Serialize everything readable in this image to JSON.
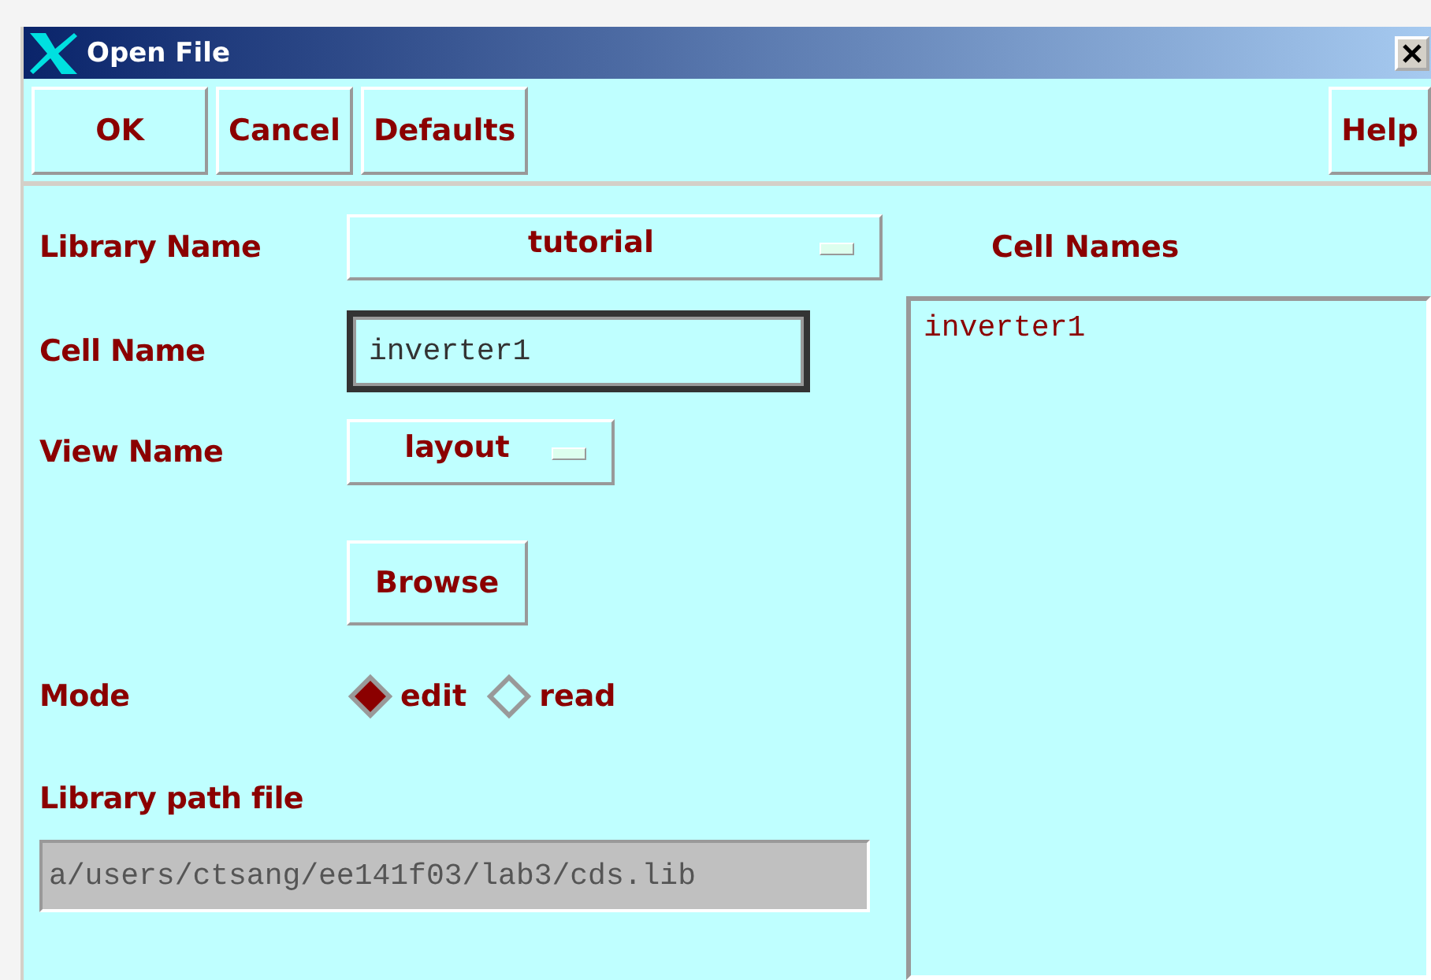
{
  "window": {
    "title": "Open File"
  },
  "toolbar": {
    "left_buttons": [
      "OK",
      "Cancel",
      "Defaults"
    ],
    "right_buttons": [
      "Help"
    ]
  },
  "library_name": {
    "label": "Library Name",
    "value": "tutorial"
  },
  "cell_name": {
    "label": "Cell Name",
    "value": "inverter1"
  },
  "view_name": {
    "label": "View Name",
    "value": "layout"
  },
  "browse_button": "Browse",
  "mode": {
    "label": "Mode",
    "options": [
      {
        "label": "edit",
        "selected": true
      },
      {
        "label": "read",
        "selected": false
      }
    ]
  },
  "library_path": {
    "label": "Library path file",
    "value": "a/users/ctsang/ee141f03/lab3/cds.lib"
  },
  "cell_names": {
    "title": "Cell Names",
    "items": [
      "inverter1"
    ]
  }
}
